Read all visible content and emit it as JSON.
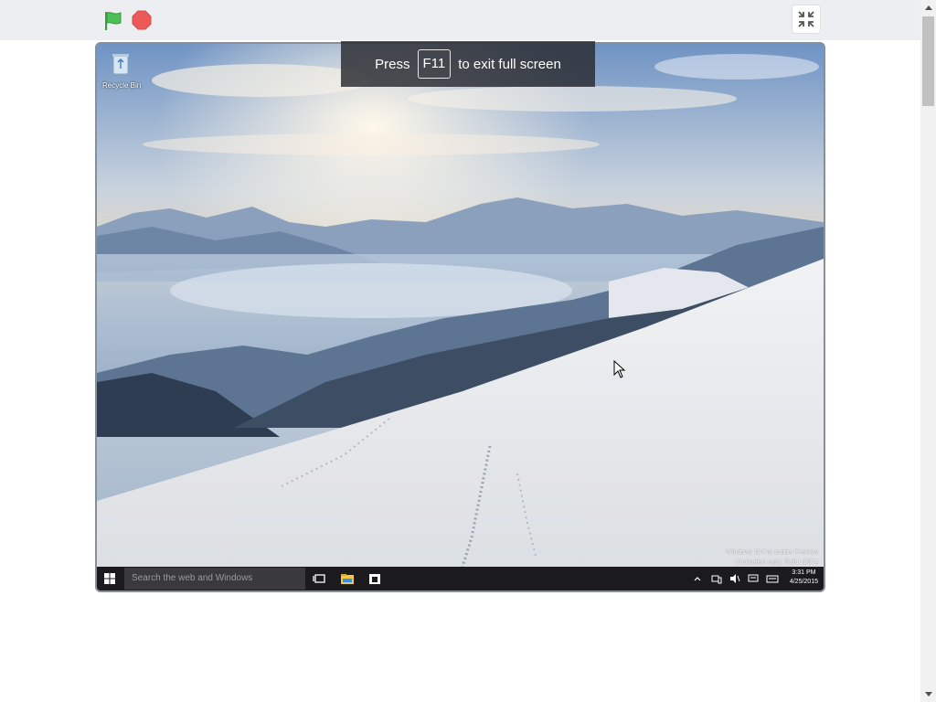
{
  "toolbar": {
    "green_flag": "green-flag-icon",
    "stop": "stop-icon",
    "fullscreen_toggle": "exit-fullscreen-icon"
  },
  "overlay": {
    "prefix": "Press",
    "key": "F11",
    "suffix": "to exit full screen"
  },
  "desktop": {
    "icons": [
      {
        "label": "Recycle Bin",
        "icon": "recycle-bin-icon"
      }
    ],
    "watermark": {
      "line1": "Windows 10 Pro Insider Preview",
      "line2": "Evaluation copy. Build 10074"
    }
  },
  "taskbar": {
    "search_placeholder": "Search the web and Windows",
    "clock_time": "3:31 PM",
    "clock_date": "4/25/2015"
  },
  "colors": {
    "toolbar_bg": "#eceef2",
    "flag_green": "#4cbf56",
    "stop_red": "#ec5959",
    "taskbar_bg": "#1b1b1d"
  }
}
